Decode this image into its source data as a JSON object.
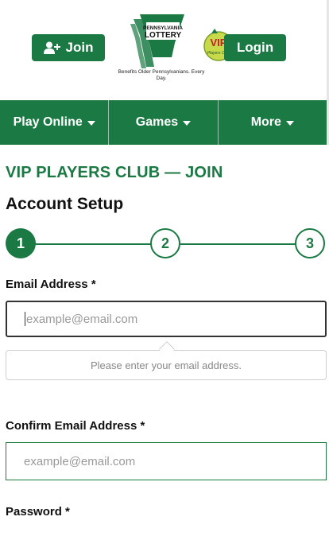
{
  "header": {
    "join_label": "Join",
    "login_label": "Login",
    "logo_line1": "PENNSYLVANIA",
    "logo_line2": "LOTTERY",
    "logo_tagline": "Benefits Older Pennsylvanians. Every Day.",
    "vip_badge_text": "VIP",
    "vip_badge_subtext": "Players Club"
  },
  "nav": {
    "items": [
      {
        "label": "Play Online"
      },
      {
        "label": "Games"
      },
      {
        "label": "More"
      }
    ]
  },
  "page": {
    "title": "VIP PLAYERS CLUB — JOIN",
    "section": "Account Setup"
  },
  "stepper": {
    "steps": [
      "1",
      "2",
      "3"
    ],
    "current_step": 1
  },
  "form": {
    "email_label": "Email Address *",
    "email_placeholder": "example@email.com",
    "email_error": "Please enter your email address.",
    "confirm_label": "Confirm Email Address *",
    "confirm_placeholder": "example@email.com",
    "password_label": "Password *"
  },
  "colors": {
    "brand_green": "#1b7a44",
    "white": "#ffffff"
  }
}
